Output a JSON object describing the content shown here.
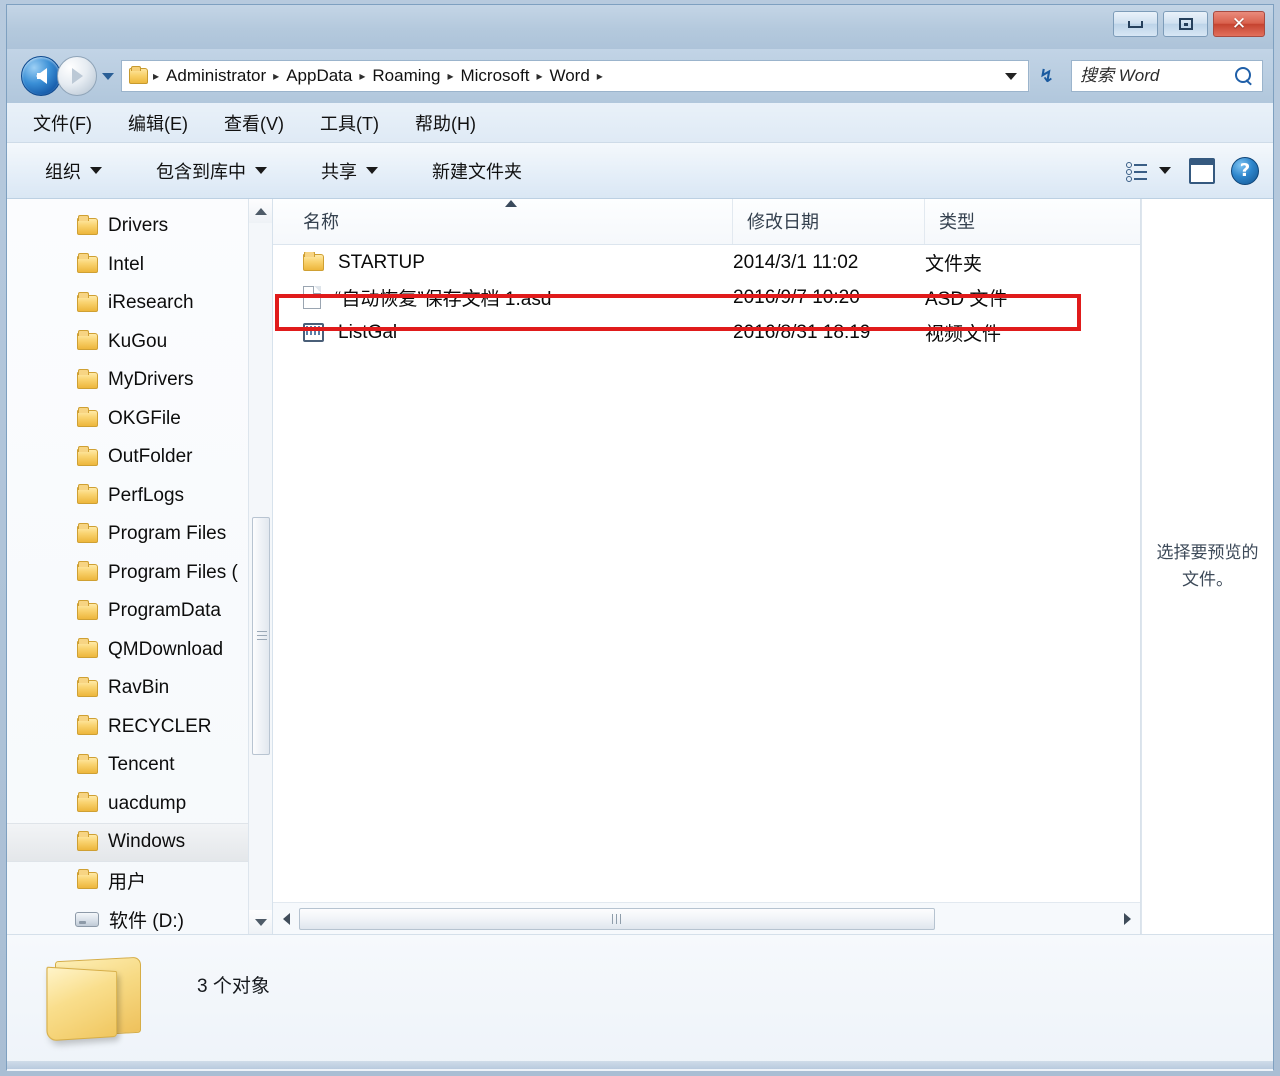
{
  "window": {
    "minimize_label": "—",
    "maximize_label": "□",
    "close_label": "✕"
  },
  "address_bar": {
    "back_tooltip": "后退",
    "forward_tooltip": "前进",
    "breadcrumbs": [
      "Administrator",
      "AppData",
      "Roaming",
      "Microsoft",
      "Word"
    ],
    "separator": "▸",
    "refresh_label": "↯"
  },
  "search": {
    "placeholder": "搜索 Word",
    "value": ""
  },
  "menubar": {
    "items": [
      {
        "label": "文件(F)"
      },
      {
        "label": "编辑(E)"
      },
      {
        "label": "查看(V)"
      },
      {
        "label": "工具(T)"
      },
      {
        "label": "帮助(H)"
      }
    ]
  },
  "toolbar": {
    "items": [
      {
        "label": "组织",
        "has_caret": true
      },
      {
        "label": "包含到库中",
        "has_caret": true
      },
      {
        "label": "共享",
        "has_caret": true
      },
      {
        "label": "新建文件夹",
        "has_caret": false
      }
    ],
    "help_label": "?"
  },
  "sidebar": {
    "items": [
      {
        "label": "Drivers",
        "icon": "folder-icon",
        "selected": false
      },
      {
        "label": "Intel",
        "icon": "folder-icon",
        "selected": false
      },
      {
        "label": "iResearch",
        "icon": "folder-icon",
        "selected": false
      },
      {
        "label": "KuGou",
        "icon": "folder-icon",
        "selected": false
      },
      {
        "label": "MyDrivers",
        "icon": "folder-icon",
        "selected": false
      },
      {
        "label": "OKGFile",
        "icon": "folder-icon",
        "selected": false
      },
      {
        "label": "OutFolder",
        "icon": "folder-icon",
        "selected": false
      },
      {
        "label": "PerfLogs",
        "icon": "folder-icon",
        "selected": false
      },
      {
        "label": "Program Files",
        "icon": "folder-icon",
        "selected": false
      },
      {
        "label": "Program Files (",
        "icon": "folder-icon",
        "selected": false
      },
      {
        "label": "ProgramData",
        "icon": "folder-icon",
        "selected": false
      },
      {
        "label": "QMDownload",
        "icon": "folder-icon",
        "selected": false
      },
      {
        "label": "RavBin",
        "icon": "folder-icon",
        "selected": false
      },
      {
        "label": "RECYCLER",
        "icon": "folder-icon",
        "selected": false
      },
      {
        "label": "Tencent",
        "icon": "folder-icon",
        "selected": false
      },
      {
        "label": "uacdump",
        "icon": "folder-icon",
        "selected": false
      },
      {
        "label": "Windows",
        "icon": "folder-icon",
        "selected": true
      },
      {
        "label": "用户",
        "icon": "folder-icon",
        "selected": false
      },
      {
        "label": "软件 (D:)",
        "icon": "drive-icon",
        "selected": false
      }
    ]
  },
  "filelist": {
    "columns": [
      {
        "label": "名称",
        "sorted": "asc"
      },
      {
        "label": "修改日期",
        "sorted": ""
      },
      {
        "label": "类型",
        "sorted": ""
      }
    ],
    "rows": [
      {
        "name": "STARTUP",
        "date": "2014/3/1 11:02",
        "type": "文件夹",
        "icon": "folder-icon",
        "highlighted": false
      },
      {
        "name": "“自动恢复”保存文档 1.asd",
        "date": "2016/9/7 10:20",
        "type": "ASD 文件",
        "icon": "document-icon",
        "highlighted": true
      },
      {
        "name": "ListGal",
        "date": "2016/8/31 18:19",
        "type": "视频文件",
        "icon": "video-icon",
        "highlighted": false
      }
    ],
    "highlight_color": "#e01b1b"
  },
  "preview": {
    "message": "选择要预览的文件。"
  },
  "statusbar": {
    "item_count_text": "3 个对象"
  }
}
